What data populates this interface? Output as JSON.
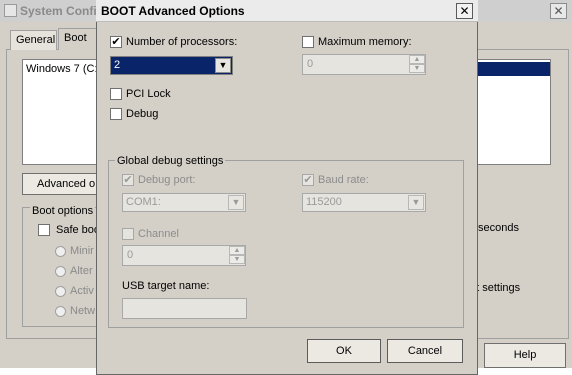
{
  "background_window": {
    "title": "System Confi",
    "tabs": [
      "General",
      "Boot"
    ],
    "os_entry": "Windows 7 (C:",
    "advanced_button": "Advanced o",
    "boot_options_label": "Boot options",
    "safe_boot_label": "Safe boo",
    "radio_options": [
      "Minir",
      "Alter",
      "Activ",
      "Netw"
    ],
    "timeout_suffix": "seconds",
    "boot_settings_suffix": "ot settings",
    "help_button": "Help"
  },
  "dialog": {
    "title": "BOOT Advanced Options",
    "close_glyph": "✕",
    "num_processors": {
      "label": "Number of processors:",
      "checked": true,
      "value": "2"
    },
    "max_memory": {
      "label": "Maximum memory:",
      "checked": false,
      "value": "0"
    },
    "pci_lock": {
      "label": "PCI Lock",
      "checked": false
    },
    "debug": {
      "label": "Debug",
      "checked": false
    },
    "global_debug_label": "Global debug settings",
    "debug_port": {
      "label": "Debug port:",
      "checked": true,
      "value": "COM1:"
    },
    "baud_rate": {
      "label": "Baud rate:",
      "checked": true,
      "value": "115200"
    },
    "channel": {
      "label": "Channel",
      "checked": false,
      "value": "0"
    },
    "usb_target_label": "USB target name:",
    "usb_target_value": "",
    "ok_button": "OK",
    "cancel_button": "Cancel"
  },
  "glyphs": {
    "check": "✔",
    "dropdown": "▼",
    "spin_up": "▲",
    "spin_down": "▼",
    "close": "✕"
  },
  "colors": {
    "selection": "#0a246a",
    "dialog_bg": "#d4d0c8",
    "disabled_text": "#8c8c8c"
  }
}
